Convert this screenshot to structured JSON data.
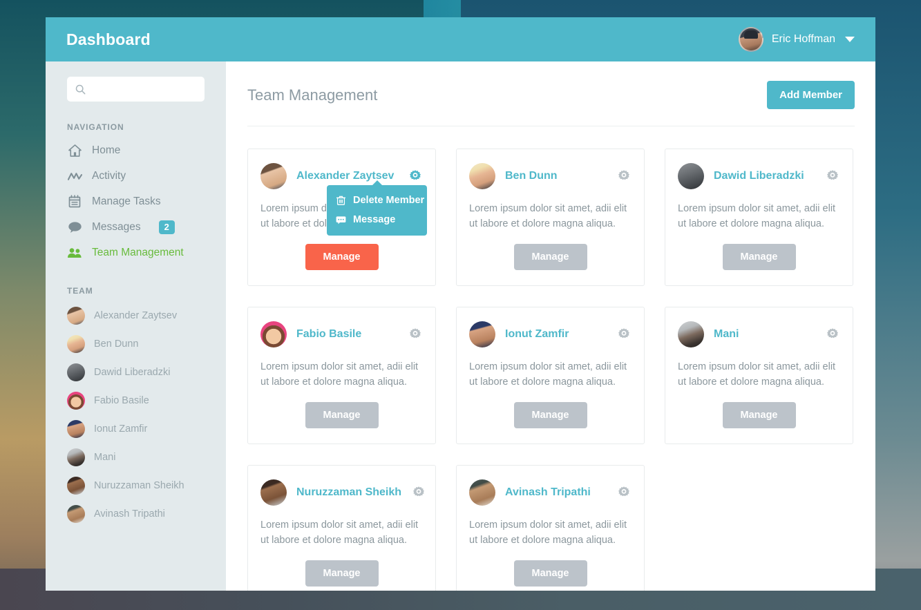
{
  "header": {
    "app_title": "Dashboard",
    "user_name": "Eric Hoffman",
    "caret_icon": "chevron-down-icon",
    "bar_color": "#4fb8ca"
  },
  "sidebar": {
    "search": {
      "value": "",
      "placeholder": "",
      "icon": "search-icon"
    },
    "nav_label": "NAVIGATION",
    "nav_items": [
      {
        "label": "Home",
        "icon": "home-icon",
        "active": false
      },
      {
        "label": "Activity",
        "icon": "activity-icon",
        "active": false
      },
      {
        "label": "Manage Tasks",
        "icon": "calendar-icon",
        "active": false
      },
      {
        "label": "Messages",
        "icon": "chat-bubble-icon",
        "active": false,
        "badge": "2"
      },
      {
        "label": "Team Management",
        "icon": "users-icon",
        "active": true
      }
    ],
    "team_label": "TEAM",
    "team_members": [
      {
        "name": "Alexander Zaytsev",
        "avatar": "av-alexander"
      },
      {
        "name": "Ben Dunn",
        "avatar": "av-ben"
      },
      {
        "name": "Dawid Liberadzki",
        "avatar": "av-dawid"
      },
      {
        "name": "Fabio Basile",
        "avatar": "av-fabio"
      },
      {
        "name": "Ionut Zamfir",
        "avatar": "av-ionut"
      },
      {
        "name": "Mani",
        "avatar": "av-mani"
      },
      {
        "name": "Nuruzzaman Sheikh",
        "avatar": "av-nuruzzaman"
      },
      {
        "name": "Avinash Tripathi",
        "avatar": "av-avinash"
      }
    ],
    "active_color": "#68bb3c",
    "badge_color": "#4fb8ca"
  },
  "main": {
    "page_title": "Team Management",
    "add_member_label": "Add Member",
    "body_text": "Lorem ipsum dolor sit amet, adii elit ut labore et dolore magna aliqua.",
    "manage_label": "Manage",
    "gear_icon": "gear-icon",
    "primary_button_color": "#f9644a",
    "cards": [
      {
        "name": "Alexander Zaytsev",
        "avatar": "av-alexander",
        "text": "Lorem ipsum dolor sit amet, adii elit ut labore et dolore magna aliqua.",
        "manage_label": "Manage",
        "active": true
      },
      {
        "name": "Ben Dunn",
        "avatar": "av-ben",
        "text": "Lorem ipsum dolor sit amet, adii elit ut labore et dolore magna aliqua.",
        "manage_label": "Manage",
        "active": false
      },
      {
        "name": "Dawid Liberadzki",
        "avatar": "av-dawid",
        "text": "Lorem ipsum dolor sit amet, adii elit ut labore et dolore magna aliqua.",
        "manage_label": "Manage",
        "active": false
      },
      {
        "name": "Fabio Basile",
        "avatar": "av-fabio",
        "text": "Lorem ipsum dolor sit amet, adii elit ut labore et dolore magna aliqua.",
        "manage_label": "Manage",
        "active": false
      },
      {
        "name": "Ionut Zamfir",
        "avatar": "av-ionut",
        "text": "Lorem ipsum dolor sit amet, adii elit ut labore et dolore magna aliqua.",
        "manage_label": "Manage",
        "active": false
      },
      {
        "name": "Mani",
        "avatar": "av-mani",
        "text": "Lorem ipsum dolor sit amet, adii elit ut labore et dolore magna aliqua.",
        "manage_label": "Manage",
        "active": false
      },
      {
        "name": "Nuruzzaman Sheikh",
        "avatar": "av-nuruzzaman",
        "text": "Lorem ipsum dolor sit amet, adii elit ut labore et dolore magna aliqua.",
        "manage_label": "Manage",
        "active": false
      },
      {
        "name": "Avinash Tripathi",
        "avatar": "av-avinash",
        "text": "Lorem ipsum dolor sit amet, adii elit ut labore et dolore magna aliqua.",
        "manage_label": "Manage",
        "active": false
      }
    ]
  },
  "popover": {
    "open_on_card": 0,
    "background": "#4fb8ca",
    "items": [
      {
        "label": "Delete Member",
        "icon": "trash-icon"
      },
      {
        "label": "Message",
        "icon": "message-icon"
      }
    ]
  }
}
